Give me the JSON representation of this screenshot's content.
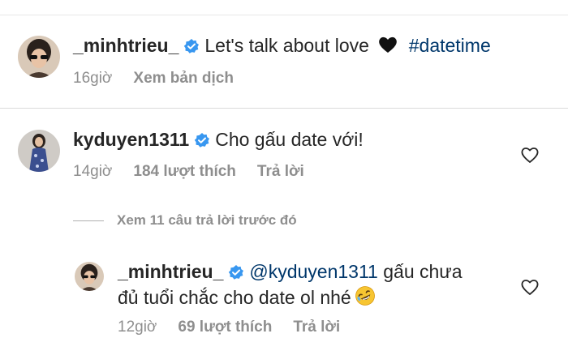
{
  "comments": [
    {
      "username": "_minhtrieu_",
      "text": "Let's talk about love",
      "emoji": "black-heart",
      "hashtag": "#datetime",
      "time": "16giờ",
      "translate": "Xem bản dịch"
    },
    {
      "username": "kyduyen1311",
      "text": "Cho gấu date với!",
      "time": "14giờ",
      "likes": "184 lượt thích",
      "reply": "Trả lời"
    }
  ],
  "view_replies": "Xem 11 câu trả lời trước đó",
  "reply": {
    "username": "_minhtrieu_",
    "mention": "@kyduyen1311",
    "text_line1": "gấu chưa",
    "text_line2": "đủ tuổi chắc cho date ol nhé",
    "emoji": "rofl-face",
    "time": "12giờ",
    "likes": "69 lượt thích",
    "reply_label": "Trả lời"
  },
  "colors": {
    "verified": "#3897f0",
    "link": "#00376b",
    "muted": "#8e8e8e",
    "text": "#262626"
  }
}
